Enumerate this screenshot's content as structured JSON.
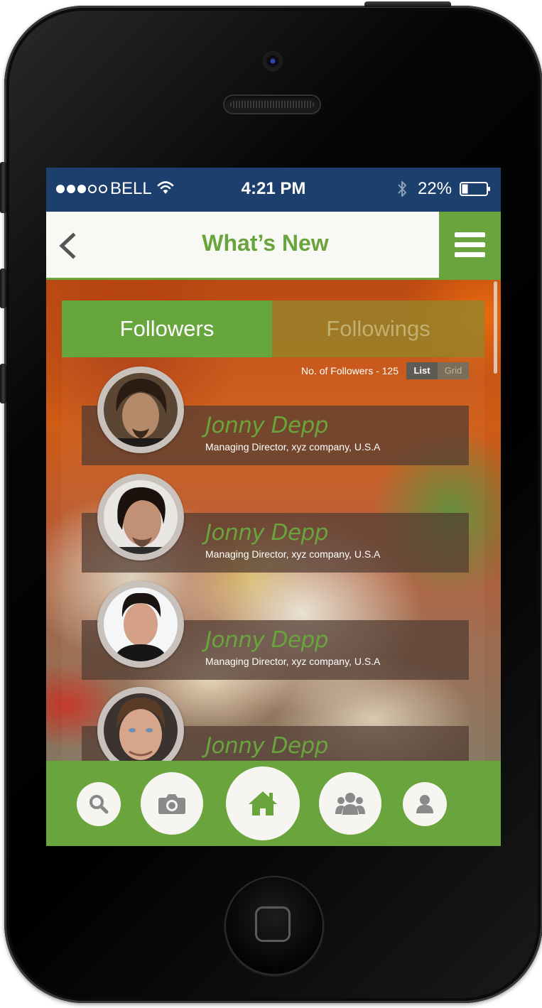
{
  "status_bar": {
    "carrier": "BELL",
    "time": "4:21 PM",
    "battery_percent": "22%",
    "signal_dots_filled": 3,
    "signal_dots_total": 5
  },
  "header": {
    "title": "What’s New",
    "back_icon": "chevron-left-icon",
    "menu_icon": "hamburger-menu-icon"
  },
  "tabs": {
    "followers": "Followers",
    "followings": "Followings",
    "active": "followers"
  },
  "list_info": {
    "count_label": "No. of Followers - 125",
    "view_list": "List",
    "view_grid": "Grid",
    "active_view": "list"
  },
  "followers": [
    {
      "name": "Jonny Depp",
      "subtitle": "Managing Director, xyz company, U.S.A"
    },
    {
      "name": "Jonny Depp",
      "subtitle": "Managing Director, xyz company, U.S.A"
    },
    {
      "name": "Jonny Depp",
      "subtitle": "Managing Director, xyz company, U.S.A"
    },
    {
      "name": "Jonny Depp",
      "subtitle": ""
    }
  ],
  "bottom_nav": [
    "search-icon",
    "camera-icon",
    "home-icon",
    "group-icon",
    "user-icon"
  ],
  "colors": {
    "accent_green": "#6aa43d",
    "status_bar_blue": "#1d3f6d",
    "header_bg": "#f8f9f4"
  }
}
